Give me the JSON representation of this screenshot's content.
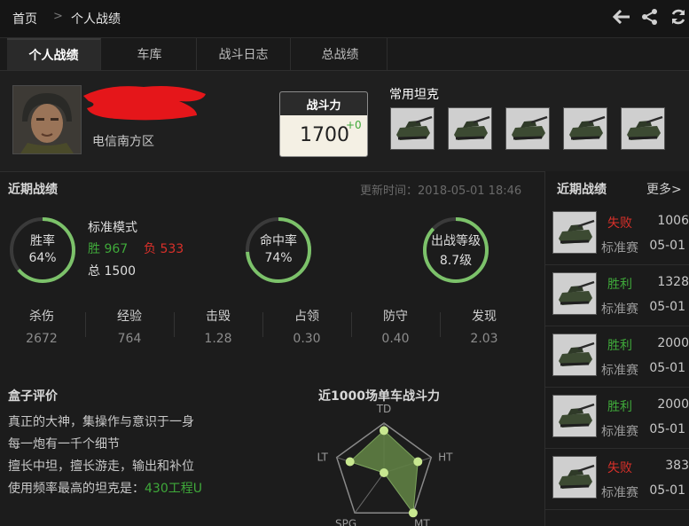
{
  "breadcrumb": {
    "home": "首页",
    "separator": ">",
    "current": "个人战绩"
  },
  "top_icons": [
    "back-arrow-icon",
    "share-icon",
    "refresh-icon"
  ],
  "tabs": [
    {
      "label": "个人战绩",
      "active": true
    },
    {
      "label": "车库",
      "active": false
    },
    {
      "label": "战斗日志",
      "active": false
    },
    {
      "label": "总战绩",
      "active": false
    }
  ],
  "profile": {
    "server": "电信南方区"
  },
  "power": {
    "title": "战斗力",
    "value": "1700",
    "delta": "+0"
  },
  "favorite_tanks": {
    "title": "常用坦克"
  },
  "recent": {
    "title": "近期战绩",
    "updated": "更新时间：2018-05-01 18:46",
    "winrate": {
      "label": "胜率",
      "value": "64%",
      "fraction": 0.64
    },
    "mode": {
      "name": "标准模式",
      "win_label": "胜 967",
      "loss_label": "负 533",
      "total_label": "总 1500"
    },
    "hitrate": {
      "label": "命中率",
      "value": "74%",
      "fraction": 0.74
    },
    "tier": {
      "label": "出战等级",
      "value": "8.7级",
      "fraction": 0.87
    },
    "stats": [
      {
        "label": "杀伤",
        "value": "2672"
      },
      {
        "label": "经验",
        "value": "764"
      },
      {
        "label": "击毁",
        "value": "1.28"
      },
      {
        "label": "占领",
        "value": "0.30"
      },
      {
        "label": "防守",
        "value": "0.40"
      },
      {
        "label": "发现",
        "value": "2.03"
      }
    ]
  },
  "box_eval": {
    "title": "盒子评价",
    "lines": [
      "真正的大神，集操作与意识于一身",
      "每一炮有一千个细节",
      "擅长中坦，擅长游走，输出和补位"
    ],
    "fav_prefix": "使用频率最高的坦克是：",
    "fav_tank": "430工程U"
  },
  "radar": {
    "title": "近1000场单车战斗力",
    "axes": [
      "TD",
      "HT",
      "MT",
      "SPG",
      "LT"
    ],
    "values": [
      0.85,
      0.72,
      1.0,
      0.0,
      0.72
    ]
  },
  "right_panel": {
    "title": "近期战绩",
    "more": "更多>",
    "battles": [
      {
        "result": "失败",
        "win": false,
        "num": "1006",
        "mode": "标准赛",
        "date": "05-01"
      },
      {
        "result": "胜利",
        "win": true,
        "num": "1328",
        "mode": "标准赛",
        "date": "05-01"
      },
      {
        "result": "胜利",
        "win": true,
        "num": "2000",
        "mode": "标准赛",
        "date": "05-01"
      },
      {
        "result": "胜利",
        "win": true,
        "num": "2000",
        "mode": "标准赛",
        "date": "05-01"
      },
      {
        "result": "失败",
        "win": false,
        "num": "383",
        "mode": "标准赛",
        "date": "05-01"
      }
    ]
  },
  "colors": {
    "win": "#3fa93a",
    "loss": "#d9302a",
    "ring": "#7cc26a",
    "ring_track": "#3a3a3a",
    "radar_fill": "#5f7f44"
  }
}
